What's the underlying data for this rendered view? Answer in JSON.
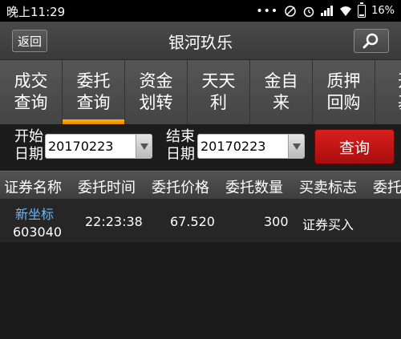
{
  "status": {
    "time": "晚上11:29",
    "battery": "16%",
    "battery_level": 0.16
  },
  "header": {
    "back_label": "返回",
    "title": "银河玖乐",
    "search_icon": "search-icon"
  },
  "tabs": [
    {
      "label": "成交\n查询",
      "active": false
    },
    {
      "label": "委托\n查询",
      "active": true
    },
    {
      "label": "资金\n划转",
      "active": false
    },
    {
      "label": "天天\n利",
      "active": false
    },
    {
      "label": "金自\n来",
      "active": false
    },
    {
      "label": "质押\n回购",
      "active": false
    },
    {
      "label": "开\n基",
      "active": false
    }
  ],
  "filter": {
    "start_label": "开始\n日期",
    "start_date": "20170223",
    "end_label": "结束\n日期",
    "end_date": "20170223",
    "query_label": "查询"
  },
  "table": {
    "columns": [
      "证券名称",
      "委托时间",
      "委托价格",
      "委托数量",
      "买卖标志",
      "委托"
    ],
    "rows": [
      {
        "name": "新坐标",
        "code": "603040",
        "time": "22:23:38",
        "price": "67.520",
        "quantity": "300",
        "side": "证券买入"
      }
    ]
  },
  "colors": {
    "accent_tab": "#f5a000",
    "query_button": "#c8181a",
    "stock_name": "#66b8ff"
  }
}
